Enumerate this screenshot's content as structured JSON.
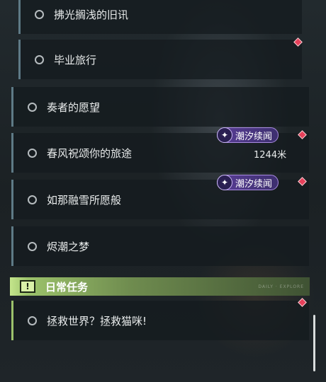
{
  "quests": [
    {
      "label": "拂光搁浅的旧讯"
    },
    {
      "label": "毕业旅行"
    },
    {
      "label": "奏者的愿望"
    },
    {
      "label": "春风祝颂你的旅途"
    },
    {
      "label": "如那融雪所愿般"
    },
    {
      "label": "烬潮之梦"
    }
  ],
  "badges": {
    "text": "潮汐续闻",
    "icon": "sparkle-icon"
  },
  "distance": "1244米",
  "daily_section": {
    "title": "日常任务",
    "tag": "DAILY · EXPLORE"
  },
  "daily_quests": [
    {
      "label": "拯救世界？拯救猫咪!"
    }
  ],
  "colors": {
    "accent_blue_gray": "#5e7a86",
    "accent_green": "#9cc26b",
    "tracker_red": "#e6405a",
    "badge_purple": "#5a3e97"
  }
}
